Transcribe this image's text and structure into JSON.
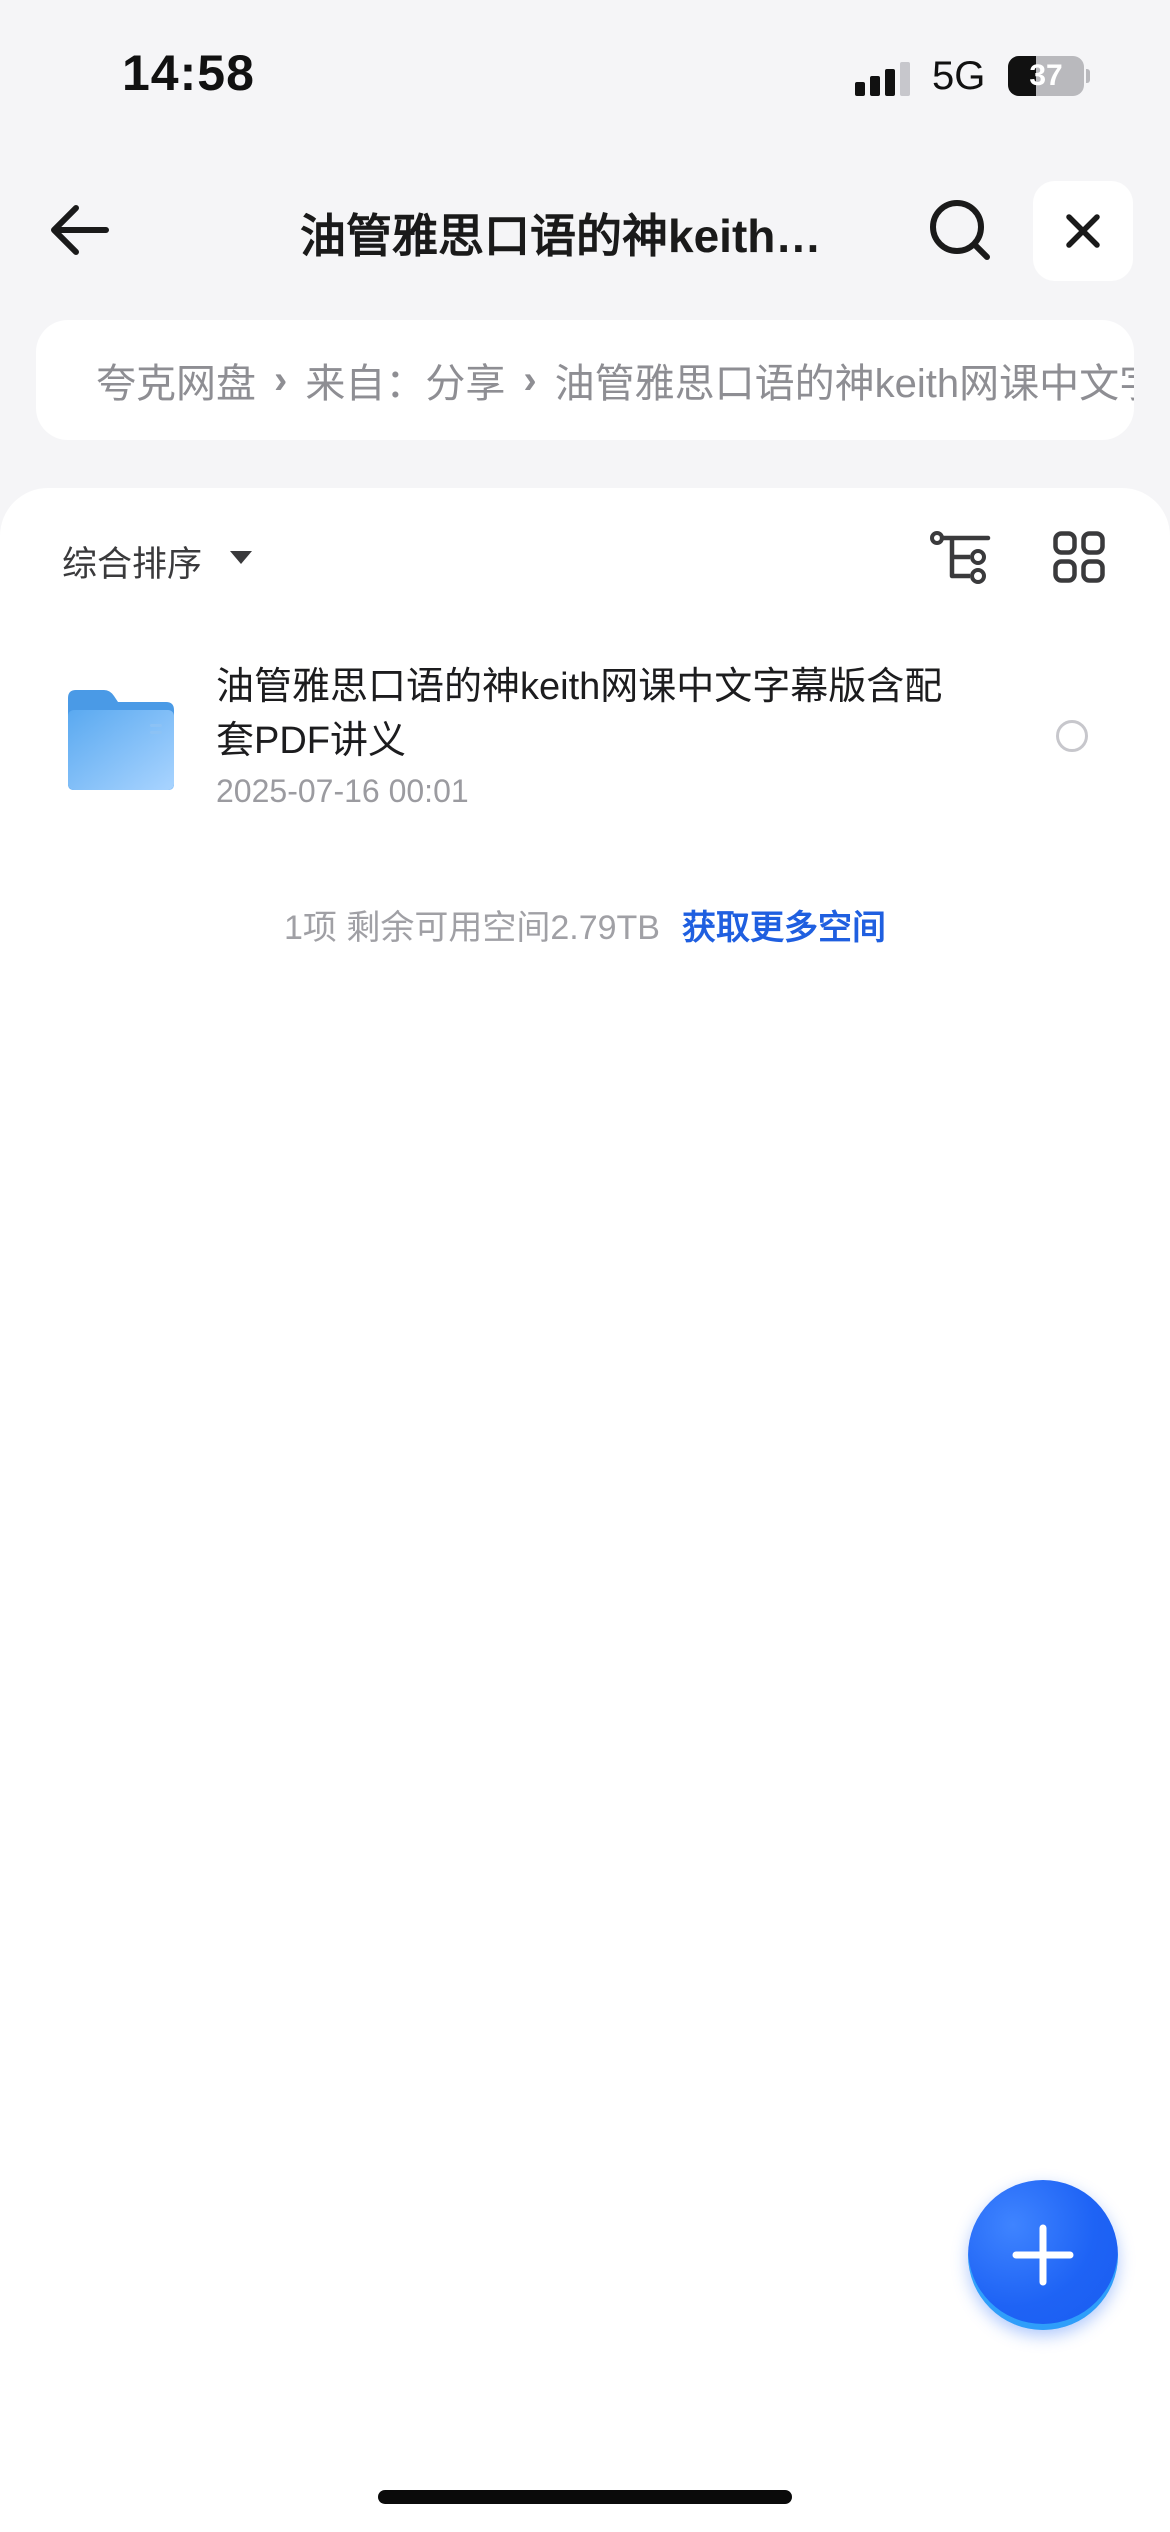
{
  "status_bar": {
    "time": "14:58",
    "network": "5G",
    "battery_level": "37"
  },
  "nav": {
    "title": "油管雅思口语的神keith网课中文字幕版含配套PDF讲义",
    "back_icon": "back-arrow-icon",
    "search_icon": "search-icon",
    "close_icon": "close-icon"
  },
  "breadcrumb": {
    "items": [
      "夸克网盘",
      "来自：分享",
      "油管雅思口语的神keith网课中文字幕版含配套PDF讲义"
    ]
  },
  "toolbar": {
    "sort_label": "综合排序",
    "tree_icon": "tree-view-icon",
    "grid_icon": "grid-view-icon"
  },
  "files": [
    {
      "name": "油管雅思口语的神keith网课中文字幕版含配套PDF讲义",
      "date": "2025-07-16 00:01",
      "icon": "folder-icon"
    }
  ],
  "footer": {
    "summary": "1项 剩余可用空间2.79TB",
    "more_space_link": "获取更多空间"
  },
  "fab": {
    "icon": "plus-icon"
  },
  "colors": {
    "accent": "#1f5fe0",
    "background": "#f5f5f7",
    "folder": "#5aa9f0"
  }
}
